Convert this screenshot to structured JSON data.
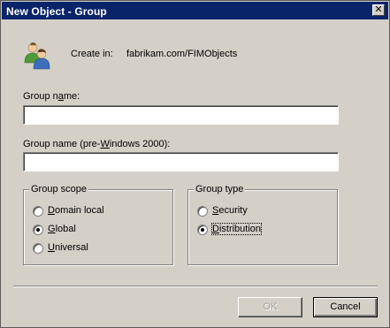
{
  "window": {
    "title": "New Object - Group",
    "close_glyph": "✕"
  },
  "header": {
    "icon": "users-group-icon",
    "create_in_label": "Create in:",
    "create_in_path": "fabrikam.com/FIMObjects"
  },
  "fields": {
    "group_name": {
      "label_pre": "Group n",
      "label_acc": "a",
      "label_post": "me:",
      "value": ""
    },
    "group_name_pre2000": {
      "label_pre": "Group name (pre-",
      "label_acc": "W",
      "label_post": "indows 2000):",
      "value": ""
    }
  },
  "group_scope": {
    "legend": "Group scope",
    "options": [
      {
        "acc": "D",
        "rest": "omain local",
        "checked": false
      },
      {
        "acc": "G",
        "rest": "lobal",
        "checked": true
      },
      {
        "acc": "U",
        "rest": "niversal",
        "checked": false
      }
    ]
  },
  "group_type": {
    "legend": "Group type",
    "options": [
      {
        "acc": "S",
        "rest": "ecurity",
        "checked": false
      },
      {
        "acc": "D",
        "rest": "istribution",
        "checked": true
      }
    ]
  },
  "buttons": {
    "ok": "OK",
    "cancel": "Cancel"
  },
  "colors": {
    "titlebar": "#0a246a",
    "dialog_bg": "#d4d0c8"
  }
}
